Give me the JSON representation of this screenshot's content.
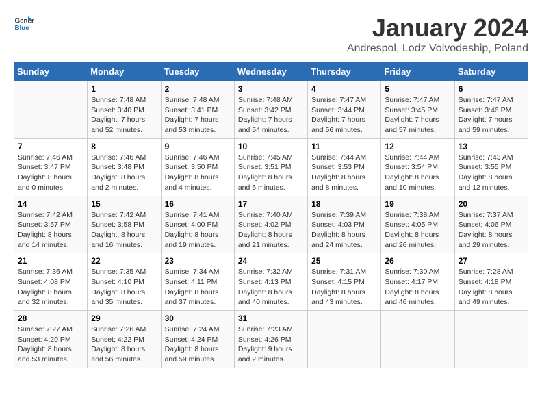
{
  "logo": {
    "line1": "General",
    "line2": "Blue"
  },
  "title": "January 2024",
  "subtitle": "Andrespol, Lodz Voivodeship, Poland",
  "headers": [
    "Sunday",
    "Monday",
    "Tuesday",
    "Wednesday",
    "Thursday",
    "Friday",
    "Saturday"
  ],
  "weeks": [
    [
      {
        "day": "",
        "sunrise": "",
        "sunset": "",
        "daylight": ""
      },
      {
        "day": "1",
        "sunrise": "Sunrise: 7:48 AM",
        "sunset": "Sunset: 3:40 PM",
        "daylight": "Daylight: 7 hours and 52 minutes."
      },
      {
        "day": "2",
        "sunrise": "Sunrise: 7:48 AM",
        "sunset": "Sunset: 3:41 PM",
        "daylight": "Daylight: 7 hours and 53 minutes."
      },
      {
        "day": "3",
        "sunrise": "Sunrise: 7:48 AM",
        "sunset": "Sunset: 3:42 PM",
        "daylight": "Daylight: 7 hours and 54 minutes."
      },
      {
        "day": "4",
        "sunrise": "Sunrise: 7:47 AM",
        "sunset": "Sunset: 3:44 PM",
        "daylight": "Daylight: 7 hours and 56 minutes."
      },
      {
        "day": "5",
        "sunrise": "Sunrise: 7:47 AM",
        "sunset": "Sunset: 3:45 PM",
        "daylight": "Daylight: 7 hours and 57 minutes."
      },
      {
        "day": "6",
        "sunrise": "Sunrise: 7:47 AM",
        "sunset": "Sunset: 3:46 PM",
        "daylight": "Daylight: 7 hours and 59 minutes."
      }
    ],
    [
      {
        "day": "7",
        "sunrise": "Sunrise: 7:46 AM",
        "sunset": "Sunset: 3:47 PM",
        "daylight": "Daylight: 8 hours and 0 minutes."
      },
      {
        "day": "8",
        "sunrise": "Sunrise: 7:46 AM",
        "sunset": "Sunset: 3:48 PM",
        "daylight": "Daylight: 8 hours and 2 minutes."
      },
      {
        "day": "9",
        "sunrise": "Sunrise: 7:46 AM",
        "sunset": "Sunset: 3:50 PM",
        "daylight": "Daylight: 8 hours and 4 minutes."
      },
      {
        "day": "10",
        "sunrise": "Sunrise: 7:45 AM",
        "sunset": "Sunset: 3:51 PM",
        "daylight": "Daylight: 8 hours and 6 minutes."
      },
      {
        "day": "11",
        "sunrise": "Sunrise: 7:44 AM",
        "sunset": "Sunset: 3:53 PM",
        "daylight": "Daylight: 8 hours and 8 minutes."
      },
      {
        "day": "12",
        "sunrise": "Sunrise: 7:44 AM",
        "sunset": "Sunset: 3:54 PM",
        "daylight": "Daylight: 8 hours and 10 minutes."
      },
      {
        "day": "13",
        "sunrise": "Sunrise: 7:43 AM",
        "sunset": "Sunset: 3:55 PM",
        "daylight": "Daylight: 8 hours and 12 minutes."
      }
    ],
    [
      {
        "day": "14",
        "sunrise": "Sunrise: 7:42 AM",
        "sunset": "Sunset: 3:57 PM",
        "daylight": "Daylight: 8 hours and 14 minutes."
      },
      {
        "day": "15",
        "sunrise": "Sunrise: 7:42 AM",
        "sunset": "Sunset: 3:58 PM",
        "daylight": "Daylight: 8 hours and 16 minutes."
      },
      {
        "day": "16",
        "sunrise": "Sunrise: 7:41 AM",
        "sunset": "Sunset: 4:00 PM",
        "daylight": "Daylight: 8 hours and 19 minutes."
      },
      {
        "day": "17",
        "sunrise": "Sunrise: 7:40 AM",
        "sunset": "Sunset: 4:02 PM",
        "daylight": "Daylight: 8 hours and 21 minutes."
      },
      {
        "day": "18",
        "sunrise": "Sunrise: 7:39 AM",
        "sunset": "Sunset: 4:03 PM",
        "daylight": "Daylight: 8 hours and 24 minutes."
      },
      {
        "day": "19",
        "sunrise": "Sunrise: 7:38 AM",
        "sunset": "Sunset: 4:05 PM",
        "daylight": "Daylight: 8 hours and 26 minutes."
      },
      {
        "day": "20",
        "sunrise": "Sunrise: 7:37 AM",
        "sunset": "Sunset: 4:06 PM",
        "daylight": "Daylight: 8 hours and 29 minutes."
      }
    ],
    [
      {
        "day": "21",
        "sunrise": "Sunrise: 7:36 AM",
        "sunset": "Sunset: 4:08 PM",
        "daylight": "Daylight: 8 hours and 32 minutes."
      },
      {
        "day": "22",
        "sunrise": "Sunrise: 7:35 AM",
        "sunset": "Sunset: 4:10 PM",
        "daylight": "Daylight: 8 hours and 35 minutes."
      },
      {
        "day": "23",
        "sunrise": "Sunrise: 7:34 AM",
        "sunset": "Sunset: 4:11 PM",
        "daylight": "Daylight: 8 hours and 37 minutes."
      },
      {
        "day": "24",
        "sunrise": "Sunrise: 7:32 AM",
        "sunset": "Sunset: 4:13 PM",
        "daylight": "Daylight: 8 hours and 40 minutes."
      },
      {
        "day": "25",
        "sunrise": "Sunrise: 7:31 AM",
        "sunset": "Sunset: 4:15 PM",
        "daylight": "Daylight: 8 hours and 43 minutes."
      },
      {
        "day": "26",
        "sunrise": "Sunrise: 7:30 AM",
        "sunset": "Sunset: 4:17 PM",
        "daylight": "Daylight: 8 hours and 46 minutes."
      },
      {
        "day": "27",
        "sunrise": "Sunrise: 7:28 AM",
        "sunset": "Sunset: 4:18 PM",
        "daylight": "Daylight: 8 hours and 49 minutes."
      }
    ],
    [
      {
        "day": "28",
        "sunrise": "Sunrise: 7:27 AM",
        "sunset": "Sunset: 4:20 PM",
        "daylight": "Daylight: 8 hours and 53 minutes."
      },
      {
        "day": "29",
        "sunrise": "Sunrise: 7:26 AM",
        "sunset": "Sunset: 4:22 PM",
        "daylight": "Daylight: 8 hours and 56 minutes."
      },
      {
        "day": "30",
        "sunrise": "Sunrise: 7:24 AM",
        "sunset": "Sunset: 4:24 PM",
        "daylight": "Daylight: 8 hours and 59 minutes."
      },
      {
        "day": "31",
        "sunrise": "Sunrise: 7:23 AM",
        "sunset": "Sunset: 4:26 PM",
        "daylight": "Daylight: 9 hours and 2 minutes."
      },
      {
        "day": "",
        "sunrise": "",
        "sunset": "",
        "daylight": ""
      },
      {
        "day": "",
        "sunrise": "",
        "sunset": "",
        "daylight": ""
      },
      {
        "day": "",
        "sunrise": "",
        "sunset": "",
        "daylight": ""
      }
    ]
  ]
}
